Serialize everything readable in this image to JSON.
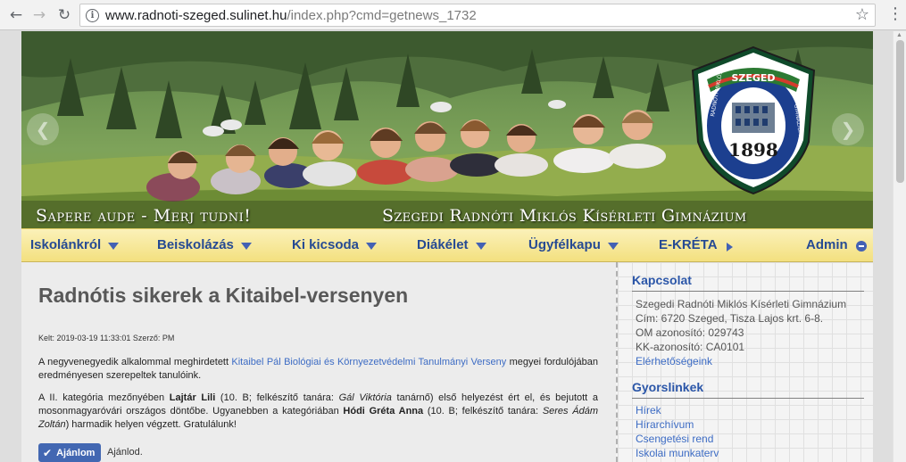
{
  "browser": {
    "url_host": "www.radnoti-szeged.sulinet.hu",
    "url_path": "/index.php?cmd=getnews_1732",
    "back_icon": "arrow-left",
    "forward_icon": "arrow-right",
    "reload_icon": "reload",
    "info_icon": "info",
    "bookmark_icon": "star",
    "menu_icon": "vertical-dots"
  },
  "banner": {
    "motto": "Sapere aude - Merj tudni!",
    "school_name": "Szegedi Radnóti Miklós Kísérleti Gimnázium",
    "logo": {
      "city": "SZEGED",
      "year": "1898",
      "ring_left": "RADNÓTI MIKLÓS",
      "ring_right": "GIMNÁZIUM"
    }
  },
  "nav": {
    "items": [
      {
        "label": "Iskolánkról"
      },
      {
        "label": "Beiskolázás"
      },
      {
        "label": "Ki kicsoda"
      },
      {
        "label": "Diákélet"
      },
      {
        "label": "Ügyfélkapu"
      },
      {
        "label": "E-KRÉTA"
      },
      {
        "label": "Admin"
      }
    ]
  },
  "article": {
    "title": "Radnótis sikerek a Kitaibel-versenyen",
    "meta": "Kelt: 2019-03-19 11:33:01 Szerző: PM",
    "p1_before": "A negyvenegyedik alkalommal meghirdetett ",
    "p1_link": "Kitaibel Pál Biológiai és Környezetvédelmi Tanulmányi Verseny",
    "p1_after": " megyei fordulójában eredményesen szerepeltek tanulóink.",
    "p2_a": "A II. kategória mezőnyében ",
    "p2_name1": "Lajtár Lili",
    "p2_b": " (10. B; felkészítő tanára: ",
    "p2_teacher1": "Gál Viktória",
    "p2_c": " tanárnő) első helyezést ért el, és bejutott a mosonmagyaróvári országos döntőbe. Ugyanebben a kategóriában ",
    "p2_name2": "Hódi Gréta Anna",
    "p2_d": " (10. B; felkészítő tanára: ",
    "p2_teacher2": "Seres Ádám Zoltán",
    "p2_e": ") harmadik helyen végzett. Gratulálunk!",
    "recommend_button": "Ajánlom",
    "recommend_text": "Ajánlod."
  },
  "sidebar": {
    "contact_heading": "Kapcsolat",
    "contact_lines": [
      "Szegedi Radnóti Miklós Kísérleti Gimnázium",
      "Cím: 6720 Szeged, Tisza Lajos krt. 6-8.",
      "OM azonosító: 029743",
      "KK-azonosító: CA0101"
    ],
    "contact_link": "Elérhetőségeink",
    "quicklinks_heading": "Gyorslinkek",
    "quicklinks": [
      "Hírek",
      "Hírarchívum",
      "Csengetési rend",
      "Iskolai munkaterv"
    ]
  }
}
